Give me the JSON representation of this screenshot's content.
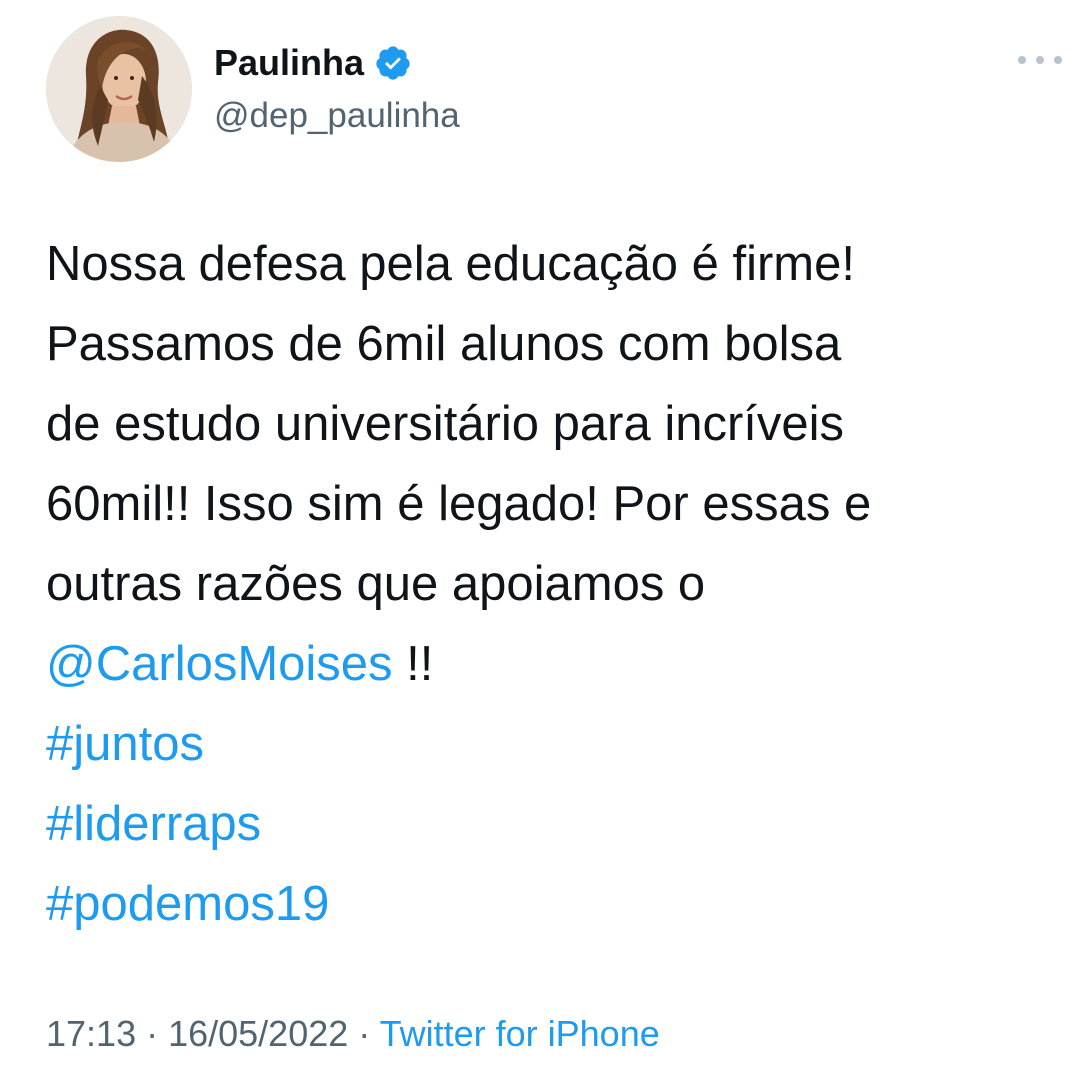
{
  "author": {
    "display_name": "Paulinha",
    "handle": "@dep_paulinha",
    "verified": true,
    "avatar_icon": "profile-photo-avatar"
  },
  "tweet": {
    "lines": [
      "Nossa defesa pela educação é firme!",
      "Passamos de 6mil alunos com bolsa",
      "de estudo universitário para incríveis",
      "60mil!! Isso sim é legado! Por essas e",
      "outras razões que apoiamos o"
    ],
    "mention": "@CarlosMoises",
    "mention_suffix": " !!",
    "hashtags": [
      "#juntos",
      "#liderraps",
      "#podemos19"
    ]
  },
  "meta": {
    "time": "17:13",
    "separator": " · ",
    "date": "16/05/2022",
    "source": "Twitter for iPhone"
  },
  "colors": {
    "link": "#1d9bf0",
    "secondary_text": "#536471",
    "primary_text": "#0f1419"
  },
  "icons": {
    "verified": "verified-badge-icon",
    "more": "more-options-icon"
  }
}
